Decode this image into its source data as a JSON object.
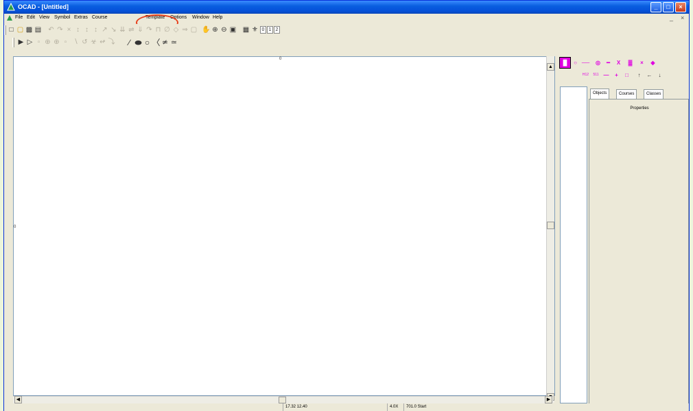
{
  "window": {
    "title": "OCAD - [Untitled]"
  },
  "menu": [
    "File",
    "Edit",
    "View",
    "Symbol",
    "Extras",
    "Course",
    "Template",
    "Options",
    "Window",
    "Help"
  ],
  "mdi_controls": [
    "_",
    "×"
  ],
  "toolbar1": {
    "layer_buttons": [
      "0",
      "1",
      "2"
    ]
  },
  "canvas": {
    "ruler_top": "0",
    "ruler_left": "0"
  },
  "panel": {
    "tabs": [
      "Objects",
      "Courses",
      "Classes"
    ],
    "properties_label": "Properties",
    "symbols": [
      "█",
      "○",
      "──",
      "◎",
      "━",
      "X",
      "▓",
      "×",
      "◆",
      "H12",
      "511",
      "—",
      "+",
      "□",
      "↑",
      "←",
      "↓"
    ]
  },
  "status": {
    "coords": "17.32  12.40",
    "zoom": "4.0X",
    "info": "701.0 Start"
  },
  "colors": {
    "title_bar": "#0A5FE0",
    "highlight_circle": "#E8421E",
    "symbol_pink": "#E000E0"
  }
}
